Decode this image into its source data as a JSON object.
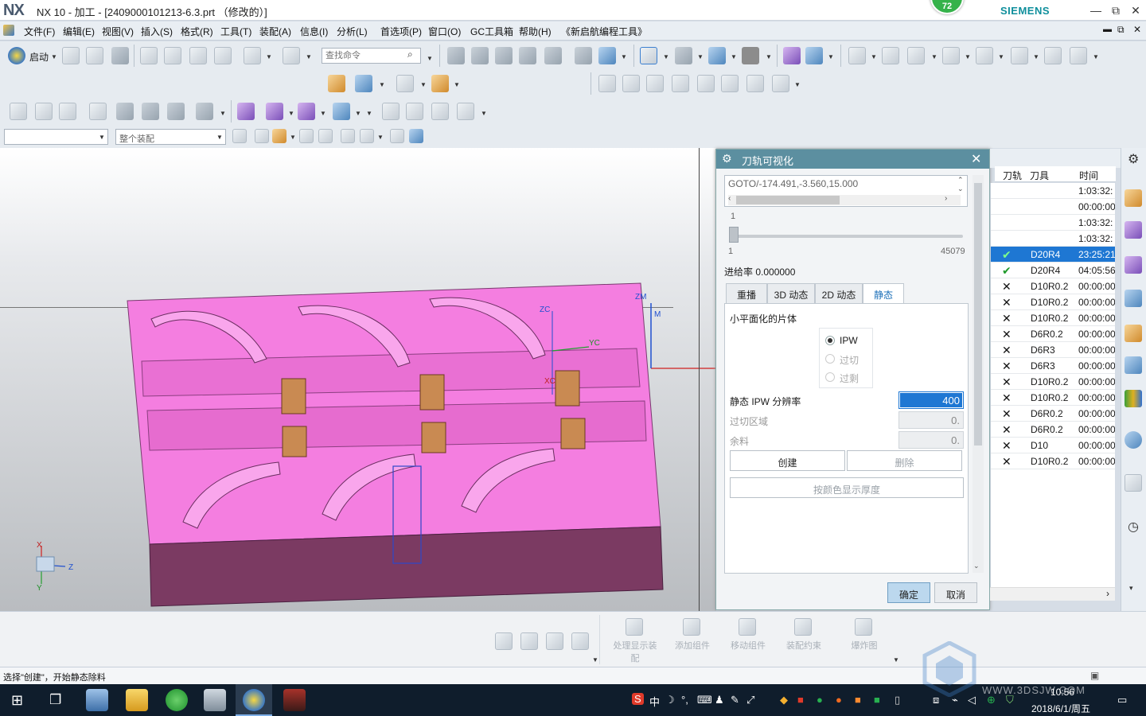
{
  "window": {
    "logo": "NX",
    "title": "NX 10 - 加工 - [2409000101213-6.3.prt （修改的）]",
    "brand": "SIEMENS",
    "badge": "72",
    "min": "—",
    "restore": "⧉",
    "close": "✕"
  },
  "menu": {
    "items": [
      "文件(F)",
      "编辑(E)",
      "视图(V)",
      "插入(S)",
      "格式(R)",
      "工具(T)",
      "装配(A)",
      "信息(I)",
      "分析(L)",
      "首选项(P)",
      "窗口(O)",
      "GC工具箱",
      "帮助(H)",
      "《新启航编程工具》"
    ]
  },
  "toolbar": {
    "start_label": "启动",
    "search_placeholder": "查找命令",
    "filter_value": "",
    "assembly_value": "整个装配"
  },
  "viewport": {
    "axis_x": "X",
    "axis_y": "Y",
    "axis_z": "Z",
    "wcs_zc": "ZC",
    "wcs_yc": "YC",
    "wcs_xc": "XC",
    "wcs_zm": "ZM",
    "wcs_m": "M",
    "part_color": "#f47ee0"
  },
  "dialog": {
    "title": "刀轨可视化",
    "goto_text": "GOTO/-174.491,-3.560,15.000",
    "slider_top": "1",
    "slider_min": "1",
    "slider_max": "45079",
    "feed_rate": "进给率 0.000000",
    "tabs": [
      "重播",
      "3D 动态",
      "2D 动态",
      "静态"
    ],
    "active_tab": "静态",
    "section_label": "小平面化的片体",
    "options": [
      "IPW",
      "过切",
      "过剩"
    ],
    "selected_option": "IPW",
    "resolution_label": "静态 IPW 分辨率",
    "resolution_value": "400",
    "overcut_label": "过切区域",
    "overcut_value": "0.",
    "stock_label": "余料",
    "stock_value": "0.",
    "create_button": "创建",
    "delete_button": "删除",
    "thickness_button": "按颜色显示厚度",
    "ok_button": "确定",
    "cancel_button": "取消"
  },
  "op_list": {
    "headers": [
      "刀轨",
      "刀具",
      "时间"
    ],
    "rows": [
      {
        "mark": "",
        "tool": "",
        "time": "1:03:32:"
      },
      {
        "mark": "",
        "tool": "",
        "time": "00:00:00"
      },
      {
        "mark": "",
        "tool": "",
        "time": "1:03:32:"
      },
      {
        "mark": "",
        "tool": "",
        "time": "1:03:32:"
      },
      {
        "mark": "✔",
        "tool": "D20R4",
        "time": "23:25:21"
      },
      {
        "mark": "✔",
        "tool": "D20R4",
        "time": "04:05:56"
      },
      {
        "mark": "✕",
        "tool": "D10R0.2",
        "time": "00:00:00"
      },
      {
        "mark": "✕",
        "tool": "D10R0.2",
        "time": "00:00:00"
      },
      {
        "mark": "✕",
        "tool": "D10R0.2",
        "time": "00:00:00"
      },
      {
        "mark": "✕",
        "tool": "D6R0.2",
        "time": "00:00:00"
      },
      {
        "mark": "✕",
        "tool": "D6R3",
        "time": "00:00:00"
      },
      {
        "mark": "✕",
        "tool": "D6R3",
        "time": "00:00:00"
      },
      {
        "mark": "✕",
        "tool": "D10R0.2",
        "time": "00:00:00"
      },
      {
        "mark": "✕",
        "tool": "D10R0.2",
        "time": "00:00:00"
      },
      {
        "mark": "✕",
        "tool": "D6R0.2",
        "time": "00:00:00"
      },
      {
        "mark": "✕",
        "tool": "D6R0.2",
        "time": "00:00:00"
      },
      {
        "mark": "✕",
        "tool": "D10",
        "time": "00:00:00"
      },
      {
        "mark": "✕",
        "tool": "D10R0.2",
        "time": "00:00:00"
      }
    ]
  },
  "bottom_tools": {
    "show_assembly": "处理显示装配",
    "add_component": "添加组件",
    "move_component": "移动组件",
    "constraint": "装配约束",
    "exploded": "爆炸图"
  },
  "status": {
    "text": "选择\"创建\"，开始静态除料"
  },
  "taskbar": {
    "time": "10:56",
    "date": "2018/6/1/周五",
    "ime": "中",
    "watermark": "WWW.3DSJW.COM"
  }
}
